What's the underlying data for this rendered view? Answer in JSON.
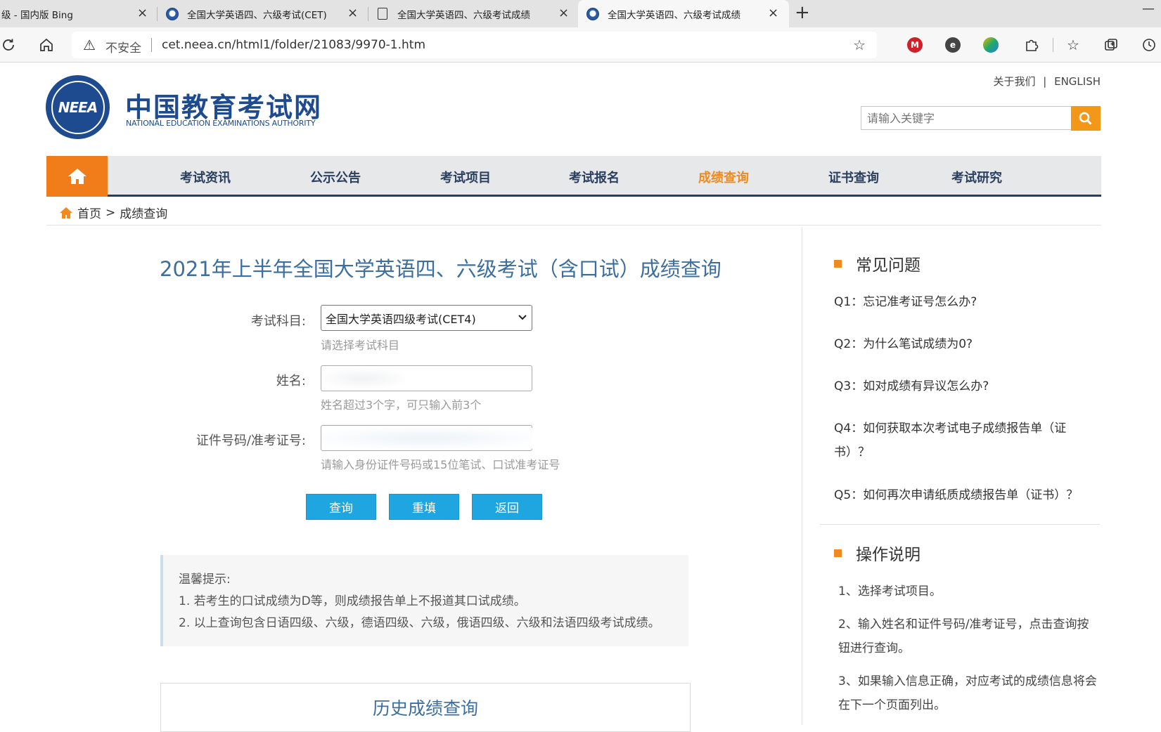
{
  "browser": {
    "tabs": [
      {
        "title": "级 - 国内版 Bing",
        "close": "×"
      },
      {
        "title": "全国大学英语四、六级考试(CET)",
        "close": "×"
      },
      {
        "title": "全国大学英语四、六级考试成绩",
        "close": "×"
      },
      {
        "title": "全国大学英语四、六级考试成绩",
        "close": "×"
      }
    ],
    "new_tab": "+",
    "minimize": "—",
    "insecure_label": "不安全",
    "url": "cet.neea.cn/html1/folder/21083/9970-1.htm"
  },
  "site": {
    "logo_text": "NEEA",
    "name": "中国教育考试网",
    "subtitle": "NATIONAL EDUCATION EXAMINATIONS AUTHORITY",
    "top_links": [
      "关于我们",
      "|",
      "ENGLISH"
    ],
    "search_placeholder": "请输入关键字"
  },
  "nav": {
    "items": [
      "考试资讯",
      "公示公告",
      "考试项目",
      "考试报名",
      "成绩查询",
      "证书查询",
      "考试研究"
    ],
    "active": "成绩查询"
  },
  "breadcrumb": {
    "home": "首页",
    "sep": ">",
    "current": "成绩查询"
  },
  "form": {
    "title": "2021年上半年全国大学英语四、六级考试（含口试）成绩查询",
    "subject_label": "考试科目:",
    "subject_value": "全国大学英语四级考试(CET4)",
    "subject_hint": "请选择考试科目",
    "name_label": "姓名:",
    "name_hint": "姓名超过3个字，可只输入前3个",
    "id_label": "证件号码/准考证号:",
    "id_hint": "请输入身份证件号码或15位笔试、口试准考证号",
    "buttons": [
      "查询",
      "重填",
      "返回"
    ]
  },
  "notice": {
    "title": "温馨提示:",
    "lines": [
      "1. 若考生的口试成绩为D等，则成绩报告单上不报道其口试成绩。",
      "2. 以上查询包含日语四级、六级，德语四级、六级，俄语四级、六级和法语四级考试成绩。"
    ]
  },
  "history_link": "历史成绩查询",
  "sidebar": {
    "faq_title": "常见问题",
    "faq": [
      "Q1：忘记准考证号怎么办?",
      "Q2：为什么笔试成绩为0?",
      "Q3：如对成绩有异议怎么办?",
      "Q4：如何获取本次考试电子成绩报告单（证书）？",
      "Q5：如何再次申请纸质成绩报告单（证书）？"
    ],
    "op_title": "操作说明",
    "ops": [
      "1、选择考试项目。",
      "2、输入姓名和证件号码/准考证号，点击查询按钮进行查询。",
      "3、如果输入信息正确，对应考试的成绩信息将会在下一个页面列出。"
    ]
  },
  "colors": {
    "brand_blue": "#1e4b8f",
    "nav_orange": "#f07c1a",
    "button_blue": "#1fa6e0",
    "title_blue": "#3c6f9f"
  }
}
